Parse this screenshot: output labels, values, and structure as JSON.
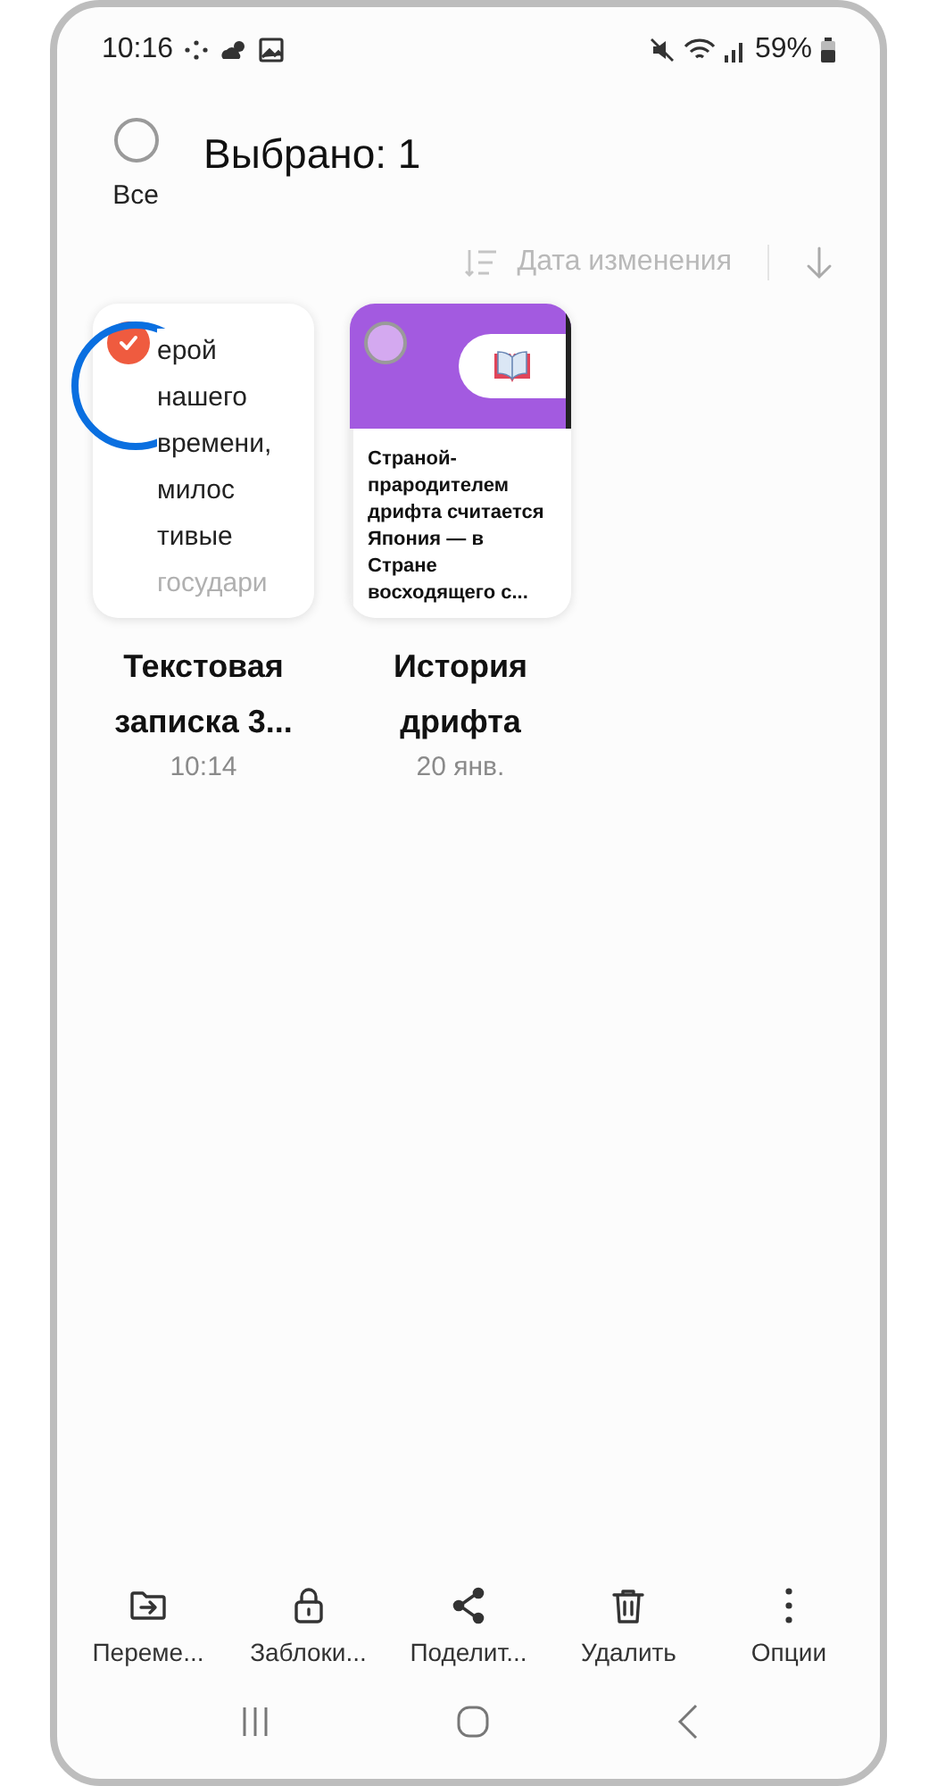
{
  "status_bar": {
    "time": "10:16",
    "battery": "59%"
  },
  "header": {
    "select_all_label": "Все",
    "all_selected": false,
    "title": "Выбрано: 1"
  },
  "sort": {
    "label": "Дата изменения"
  },
  "notes": [
    {
      "kind": "text",
      "selected": true,
      "preview": [
        "ерой",
        "нашего",
        "времени,",
        "милос",
        "тивые",
        "государи"
      ],
      "title": "Текстовая записка 3...",
      "date": "10:14"
    },
    {
      "kind": "notebook",
      "selected": false,
      "preview": [
        "Страной-прародителем дрифта считается Япония — в Стране восходящего с..."
      ],
      "title": "История дрифта",
      "date": "20 янв."
    }
  ],
  "actions": [
    {
      "kind": "move",
      "label": "Переме..."
    },
    {
      "kind": "lock",
      "label": "Заблоки..."
    },
    {
      "kind": "share",
      "label": "Поделит..."
    },
    {
      "kind": "delete",
      "label": "Удалить"
    },
    {
      "kind": "more",
      "label": "Опции"
    }
  ]
}
